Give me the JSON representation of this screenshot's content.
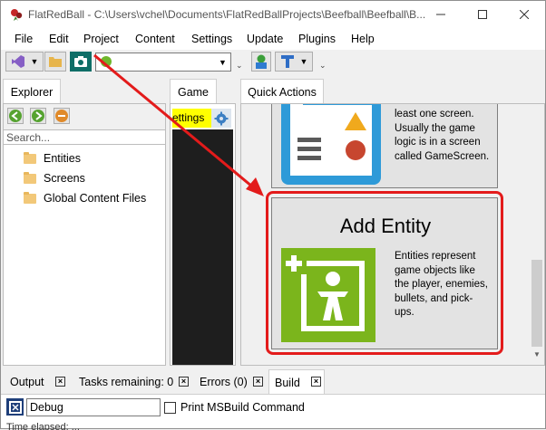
{
  "window": {
    "title": "FlatRedBall - C:\\Users\\vchel\\Documents\\FlatRedBallProjects\\Beefball\\Beefball\\B...",
    "minimize_icon": "minimize-icon",
    "maximize_icon": "maximize-icon",
    "close_icon": "close-icon"
  },
  "menu": {
    "items": [
      "File",
      "Edit",
      "Project",
      "Content",
      "Settings",
      "Update",
      "Plugins",
      "Help"
    ]
  },
  "toolbar": {
    "icons": [
      "visual-studio-icon",
      "folder-open-icon",
      "camera-icon",
      "glue-view-icon",
      "gum-icon"
    ],
    "combo_value": ""
  },
  "explorer": {
    "tab_label": "Explorer",
    "search_placeholder": "Search...",
    "tree": [
      "Entities",
      "Screens",
      "Global Content Files"
    ]
  },
  "game": {
    "tab_label": "Game",
    "settings_label": "ettings"
  },
  "quick_actions": {
    "tab_label": "Quick Actions",
    "screen_card_desc": [
      "least one screen.",
      "Usually the game",
      "logic is in a screen",
      "called GameScreen."
    ],
    "entity_card_title": "Add Entity",
    "entity_card_desc": [
      "Entities represent",
      "game objects like",
      "the player, enemies,",
      "bullets, and pick-",
      "ups."
    ]
  },
  "bottom": {
    "tabs": [
      "Output",
      "Tasks remaining: 0",
      "Errors (0)",
      "Build"
    ],
    "active_tab": "Build",
    "config_value": "Debug",
    "checkbox_label": "Print MSBuild Command",
    "status_text": "Time elapsed: ..."
  },
  "colors": {
    "highlight_red": "#e31b1b",
    "settings_yellow": "#ffff00",
    "entity_green": "#7bb51c"
  }
}
